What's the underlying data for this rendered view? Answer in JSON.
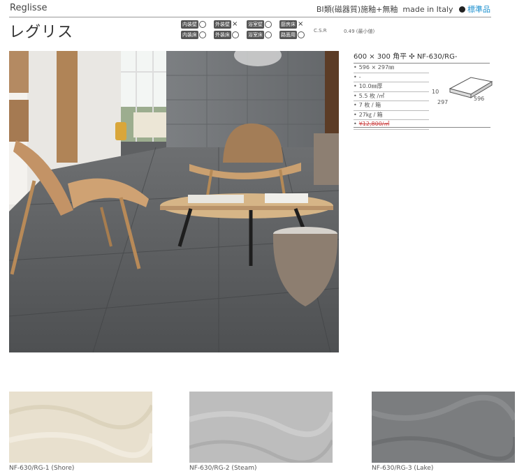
{
  "header": {
    "title_en": "Reglisse",
    "title_jp": "レグリス",
    "classification": "BI類(磁器質)施釉+無釉",
    "origin": "made in Italy",
    "standard": "標準品"
  },
  "usage": {
    "rows": [
      [
        {
          "label": "内装壁",
          "mark": "○"
        },
        {
          "label": "外装壁",
          "mark": "×"
        },
        {
          "label": "浴室壁",
          "mark": "○"
        },
        {
          "label": "厨房床",
          "mark": "×"
        }
      ],
      [
        {
          "label": "内装床",
          "mark": "○"
        },
        {
          "label": "外装床",
          "mark": "○"
        },
        {
          "label": "浴室床",
          "mark": "○"
        },
        {
          "label": "路面用",
          "mark": "○"
        }
      ]
    ],
    "csr_label": "C.S.R",
    "friction_value": "0.49 (最小値)"
  },
  "spec": {
    "title": "600 × 300 角平 ✣ NF-630/RG-",
    "items": [
      {
        "text": "596 × 297㎜",
        "strike": false
      },
      {
        "text": "-",
        "strike": false
      },
      {
        "text": "10.0㎜厚",
        "strike": false
      },
      {
        "text": "5.5 枚 /㎡",
        "strike": false
      },
      {
        "text": "7 枚 / 箱",
        "strike": false
      },
      {
        "text": "27㎏ / 箱",
        "strike": false
      },
      {
        "text": "¥12,800/㎡",
        "strike": true
      }
    ],
    "drawing": {
      "thickness": "10",
      "width": "596",
      "depth": "297"
    }
  },
  "swatches": [
    {
      "label": "NF-630/RG-1 (Shore)",
      "color": "#e8e0ce"
    },
    {
      "label": "NF-630/RG-2 (Steam)",
      "color": "#bdbdbd"
    },
    {
      "label": "NF-630/RG-3 (Lake)",
      "color": "#7b7d7f"
    }
  ]
}
